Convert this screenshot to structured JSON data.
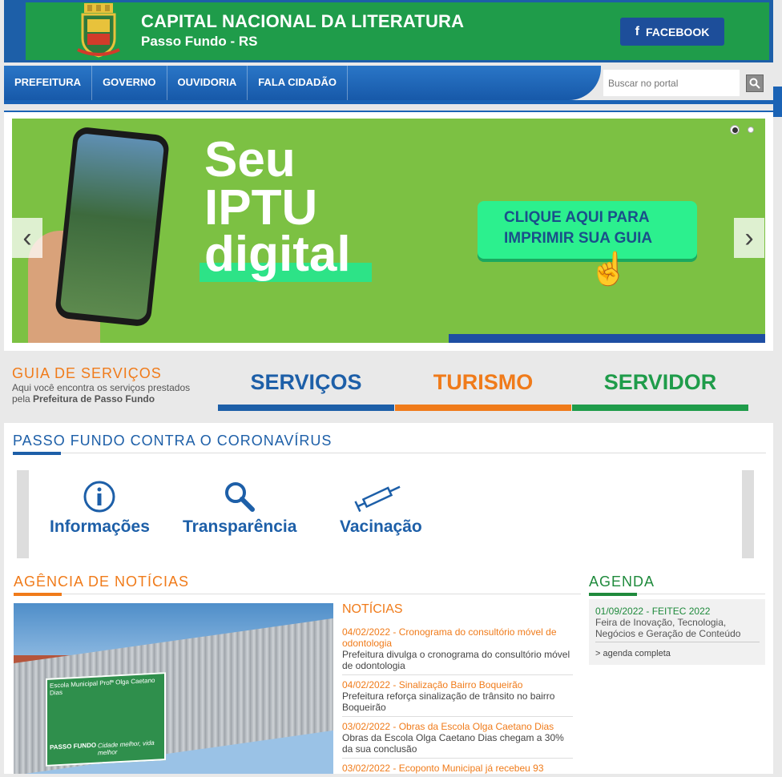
{
  "header": {
    "title": "CAPITAL NACIONAL DA LITERATURA",
    "subtitle": "Passo Fundo - RS",
    "facebook_label": "FACEBOOK"
  },
  "nav": {
    "items": [
      "PREFEITURA",
      "GOVERNO",
      "OUVIDORIA",
      "FALA CIDADÃO"
    ],
    "search_placeholder": "Buscar no portal"
  },
  "banner": {
    "line1": "Seu",
    "line2": "IPTU",
    "line3": "digital",
    "cta_line1": "CLIQUE AQUI PARA",
    "cta_line2": "IMPRIMIR SUA GUIA"
  },
  "guia": {
    "title": "GUIA DE SERVIÇOS",
    "desc_plain": "Aqui você encontra os serviços prestados pela ",
    "desc_bold": "Prefeitura de Passo Fundo",
    "tabs": [
      "SERVIÇOS",
      "TURISMO",
      "SERVIDOR"
    ]
  },
  "corona": {
    "title": "PASSO FUNDO CONTRA O CORONAVÍRUS",
    "items": [
      "Informações",
      "Transparência",
      "Vacinação"
    ]
  },
  "news": {
    "section_title": "AGÊNCIA DE NOTÍCIAS",
    "list_title": "NOTÍCIAS",
    "photo_sign_title": "Escola Municipal Profª Olga Caetano Dias",
    "photo_sign_brand": "PASSO FUNDO",
    "photo_sign_slogan": "Cidade melhor, vida melhor",
    "items": [
      {
        "date_title": "04/02/2022 - Cronograma do consultório móvel de odontologia",
        "summary": "Prefeitura divulga o cronograma do consultório móvel de odontologia"
      },
      {
        "date_title": "04/02/2022 - Sinalização Bairro Boqueirão",
        "summary": "Prefeitura reforça sinalização de trânsito no bairro Boqueirão"
      },
      {
        "date_title": "03/02/2022 - Obras da Escola Olga Caetano Dias",
        "summary": "Obras da Escola Olga Caetano Dias chegam a 30% da sua conclusão"
      },
      {
        "date_title": "03/02/2022 - Ecoponto Municipal já recebeu 93",
        "summary": ""
      }
    ]
  },
  "agenda": {
    "title": "AGENDA",
    "date_title": "01/09/2022 - FEITEC 2022",
    "desc": "Feira de Inovação, Tecnologia, Negócios e Geração de Conteúdo",
    "link": "> agenda completa"
  },
  "colors": {
    "blue": "#1d5fa8",
    "green": "#1f9c4a",
    "orange": "#f07b1a"
  }
}
